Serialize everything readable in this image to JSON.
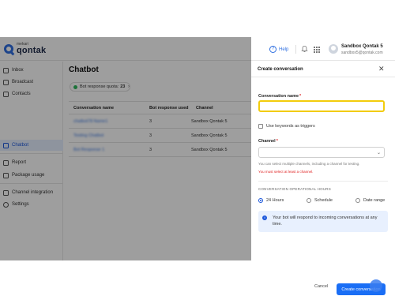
{
  "header": {
    "logo_small": "mekari",
    "logo_big": "qontak",
    "help_label": "Help",
    "user_name": "Sandbox Qontak 5",
    "user_email": "sandbox5@qontak.com"
  },
  "sidebar": {
    "items": [
      {
        "label": "Inbox",
        "icon": "inbox-icon"
      },
      {
        "label": "Broadcast",
        "icon": "broadcast-icon"
      },
      {
        "label": "Contacts",
        "icon": "contacts-icon"
      },
      {
        "label": "Chatbot",
        "icon": "chatbot-icon"
      },
      {
        "label": "Report",
        "icon": "report-icon"
      },
      {
        "label": "Package usage",
        "icon": "package-icon"
      },
      {
        "label": "Channel integration",
        "icon": "channel-icon"
      },
      {
        "label": "Settings",
        "icon": "gear-icon"
      }
    ],
    "active": "Chatbot"
  },
  "main": {
    "title": "Chatbot",
    "quota_label": "Bot response quota:",
    "quota_value": "23",
    "columns": [
      "Conversation name",
      "Bot response used",
      "Channel"
    ],
    "rows": [
      {
        "name": "chatbot78 Name1",
        "used": "3",
        "channel": "Sandbox Qontak 5"
      },
      {
        "name": "Testing Chatbot",
        "used": "3",
        "channel": "Sandbox Qontak 5"
      },
      {
        "name": "Bot Response 1",
        "used": "3",
        "channel": "Sandbox Qontak 5"
      }
    ]
  },
  "drawer": {
    "title": "Create conversation",
    "name_label": "Conversation name",
    "name_value": "",
    "keywords_label": "Use keywords as triggers",
    "channel_label": "Channel",
    "channel_hint": "You can select multiple channels, including a channel for testing.",
    "channel_error": "You must select at least a channel.",
    "hours_section": "CONVERSATION OPERATIONAL HOURS",
    "hours_options": [
      "24 Hours",
      "Schedule",
      "Date range"
    ],
    "hours_selected": "24 Hours",
    "info_text": "Your bot will respond to incoming conversations at any time.",
    "cancel_label": "Cancel",
    "create_label": "Create conversation"
  },
  "colors": {
    "accent": "#1a6ef5",
    "input_focus": "#f2cc0c",
    "error": "#e02424"
  }
}
